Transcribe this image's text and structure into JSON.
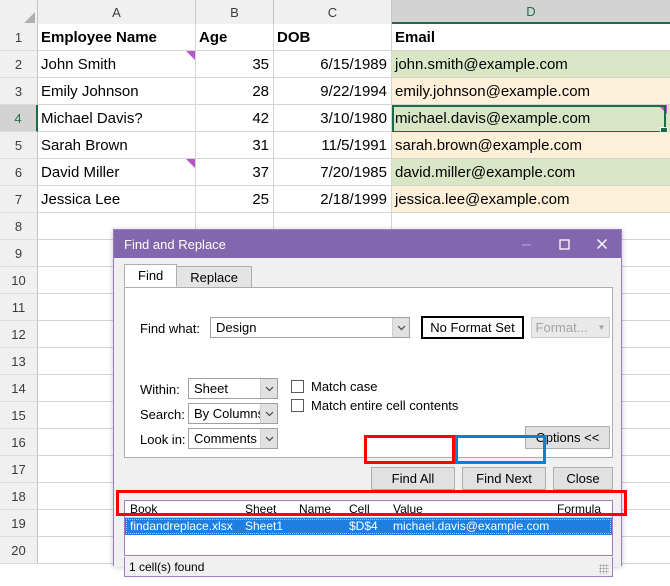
{
  "spreadsheet": {
    "columns": [
      {
        "label": "A",
        "active": false
      },
      {
        "label": "B",
        "active": false
      },
      {
        "label": "C",
        "active": false
      },
      {
        "label": "D",
        "active": true
      }
    ],
    "row_numbers": [
      "1",
      "2",
      "3",
      "4",
      "5",
      "6",
      "7",
      "8",
      "9",
      "10",
      "11",
      "12",
      "13",
      "14",
      "15",
      "16",
      "17",
      "18",
      "19",
      "20"
    ],
    "active_row": "4",
    "active_cell": "D4",
    "headers": {
      "a": "Employee Name",
      "b": "Age",
      "c": "DOB",
      "d": "Email"
    },
    "rows": [
      {
        "name": "John Smith",
        "age": "35",
        "dob": "6/15/1989",
        "email": "john.smith@example.com",
        "fill": "green",
        "comment": true
      },
      {
        "name": "Emily Johnson",
        "age": "28",
        "dob": "9/22/1994",
        "email": "emily.johnson@example.com",
        "fill": "cream",
        "comment": false
      },
      {
        "name": "Michael Davis?",
        "age": "42",
        "dob": "3/10/1980",
        "email": "michael.davis@example.com",
        "fill": "green",
        "comment": false,
        "email_comment": true
      },
      {
        "name": "Sarah Brown",
        "age": "31",
        "dob": "11/5/1991",
        "email": "sarah.brown@example.com",
        "fill": "cream",
        "comment": false
      },
      {
        "name": "David Miller",
        "age": "37",
        "dob": "7/20/1985",
        "email": "david.miller@example.com",
        "fill": "green",
        "comment": true
      },
      {
        "name": "Jessica Lee",
        "age": "25",
        "dob": "2/18/1999",
        "email": "jessica.lee@example.com",
        "fill": "cream",
        "comment": false
      }
    ],
    "comment_color": "#b456c8",
    "fill_green": "#d8e6c5",
    "fill_cream": "#fdf0d8",
    "selection_color": "#1d6b44"
  },
  "dialog": {
    "title": "Find and Replace",
    "accent_color": "#8266ae",
    "window_buttons": {
      "minimize": "minimize-icon",
      "maximize": "maximize-icon",
      "close": "close-icon"
    },
    "tabs": [
      {
        "label": "Find",
        "active": true
      },
      {
        "label": "Replace",
        "active": false
      }
    ],
    "find_what_label": "Find what:",
    "find_what_value": "Design",
    "find_what_placeholder": "",
    "no_format_set_label": "No Format Set",
    "format_label": "Format...",
    "within_label": "Within:",
    "within_value": "Sheet",
    "search_label": "Search:",
    "search_value": "By Columns",
    "look_in_label": "Look in:",
    "look_in_value": "Comments",
    "match_case_label": "Match case",
    "match_entire_label": "Match entire cell contents",
    "match_case_checked": false,
    "match_entire_checked": false,
    "options_label": "Options <<",
    "buttons": {
      "find_all": "Find All",
      "find_next": "Find Next",
      "close": "Close"
    },
    "results": {
      "columns": [
        "Book",
        "Sheet",
        "Name",
        "Cell",
        "Value",
        "Formula"
      ],
      "rows": [
        {
          "book": "findandreplace.xlsx",
          "sheet": "Sheet1",
          "name": "",
          "cell": "$D$4",
          "value": "michael.davis@example.com",
          "formula": "",
          "selected": true
        }
      ]
    },
    "status": "1 cell(s) found"
  },
  "annotations": {
    "find_all_highlight_color": "#ff0000",
    "find_next_highlight_color": "#0b7fd4",
    "result_row_highlight_color": "#ff0000"
  }
}
